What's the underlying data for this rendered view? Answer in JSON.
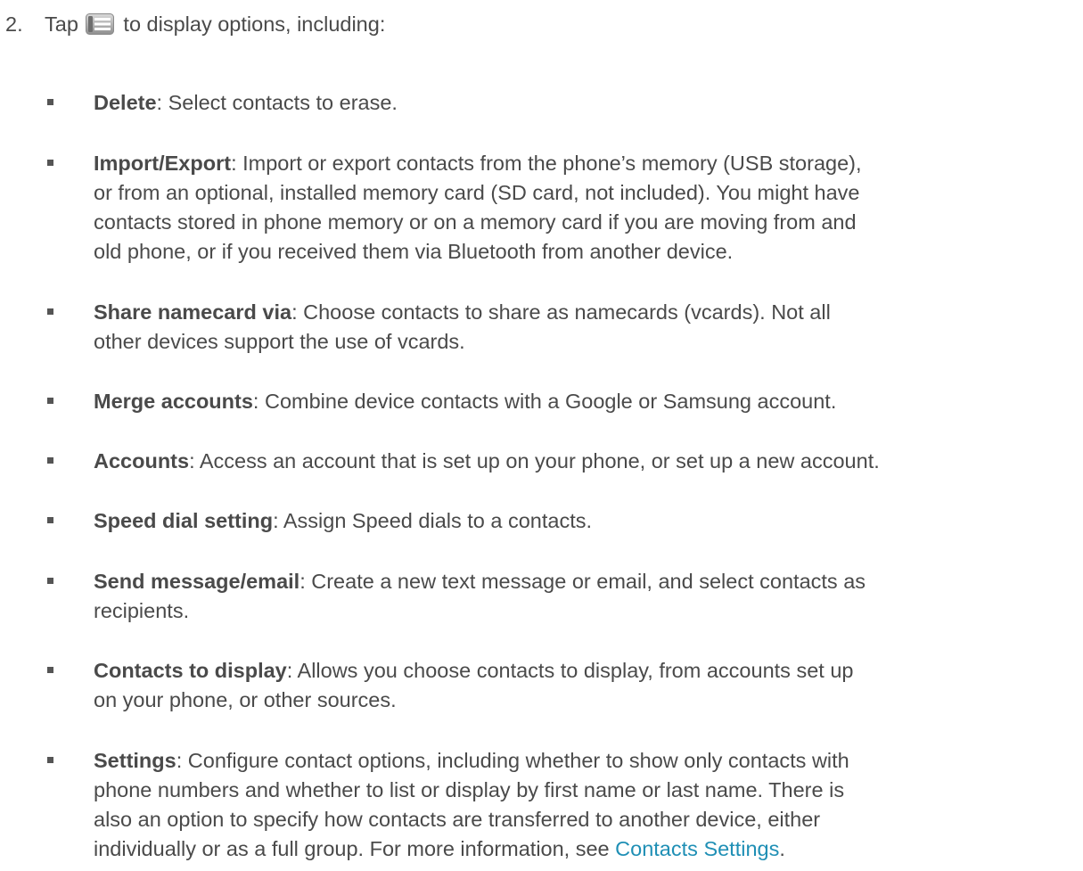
{
  "step": {
    "number": "2.",
    "text_before": "Tap",
    "icon": "menu-key-icon",
    "text_after": "to display options, including:"
  },
  "items": [
    {
      "term": "Delete",
      "lines": [
        ": Select contacts to erase."
      ]
    },
    {
      "term": "Import/Export",
      "lines": [
        ": Import or export contacts from the phone’s memory (USB storage),",
        "or from an optional, installed memory card (SD card, not included). You might have",
        "contacts stored in phone memory or on a memory card if you are moving from and",
        "old phone, or if you received them via Bluetooth from another device."
      ]
    },
    {
      "term": "Share namecard via",
      "lines": [
        ": Choose contacts to share as namecards (vcards). Not all",
        "other devices support the use of vcards."
      ]
    },
    {
      "term": "Merge accounts",
      "lines": [
        ": Combine device contacts with a Google or Samsung account."
      ]
    },
    {
      "term": "Accounts",
      "lines": [
        ": Access an account that is set up on your phone, or set up a new account."
      ]
    },
    {
      "term": "Speed dial setting",
      "lines": [
        ": Assign Speed dials to a contacts."
      ]
    },
    {
      "term": "Send message/email",
      "lines": [
        ": Create a new text message or email, and select contacts as",
        "recipients."
      ]
    },
    {
      "term": "Contacts to display",
      "lines": [
        ": Allows you choose contacts to display, from accounts set up",
        "on your phone, or other sources."
      ]
    },
    {
      "term": "Settings",
      "lines": [
        ": Configure contact options, including whether to show only contacts with",
        "phone numbers and whether to list or display by first name or last name. There is",
        "also an option to specify how contacts are transferred to another device, either",
        "individually or as a full group. For more information, see "
      ],
      "link": "Contacts Settings",
      "after_link": "."
    }
  ]
}
